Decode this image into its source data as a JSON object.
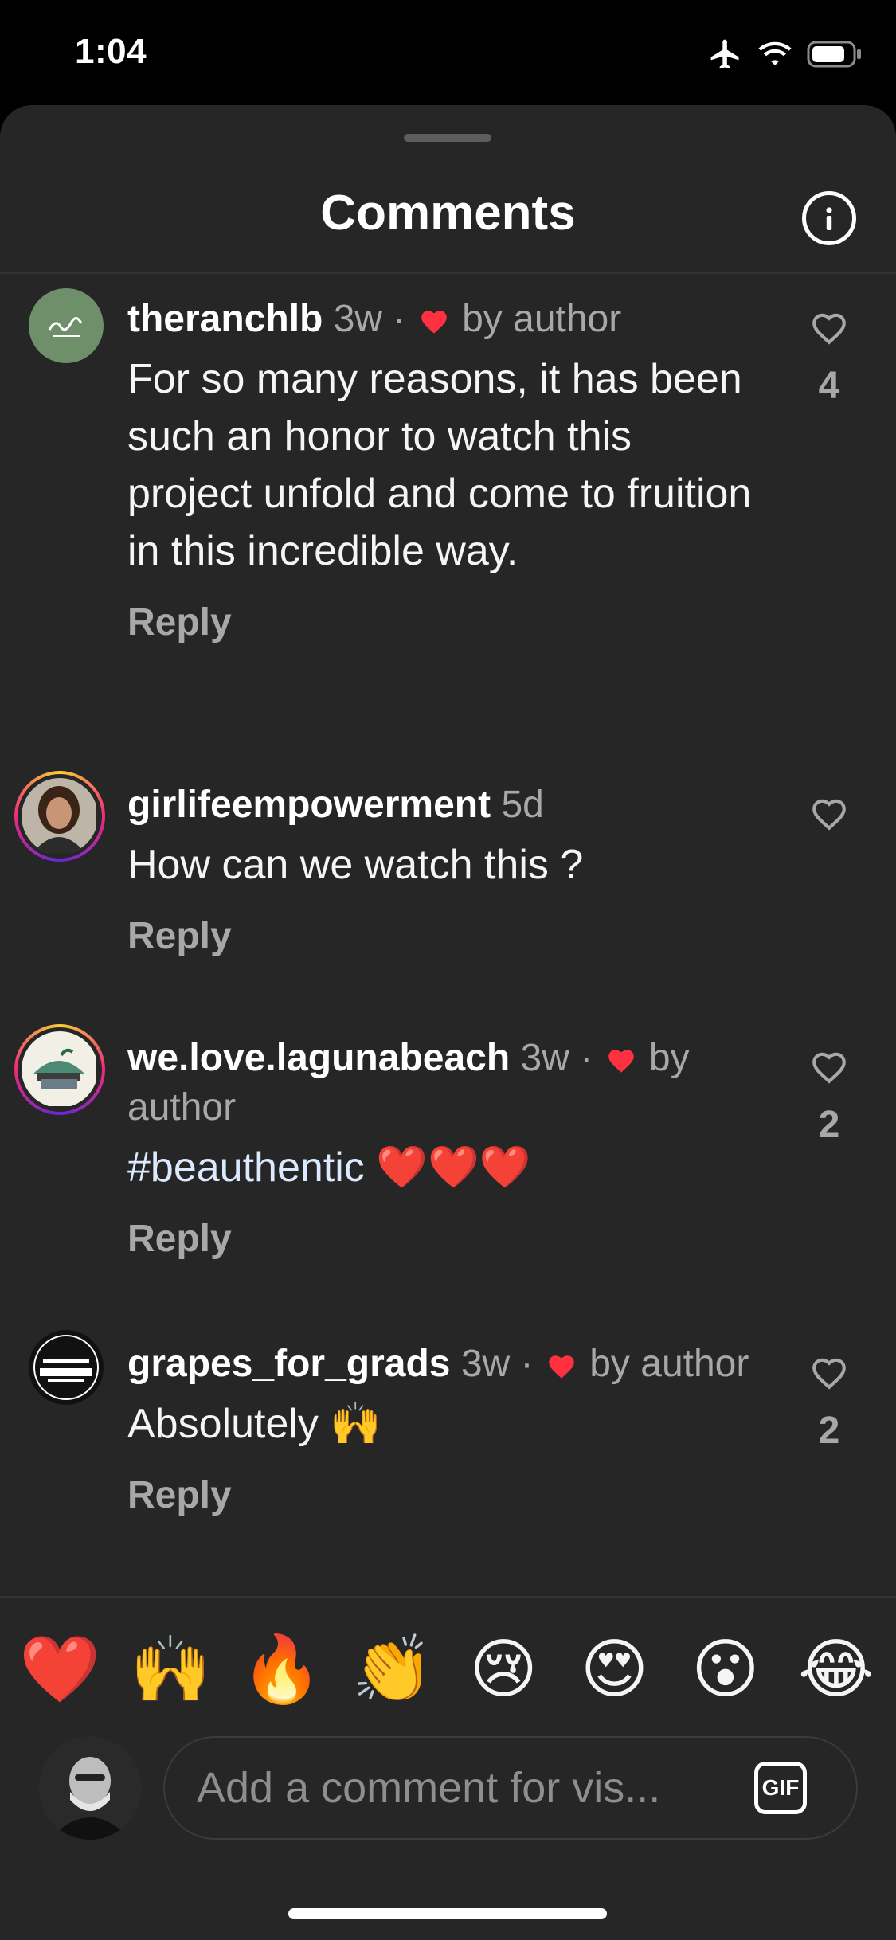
{
  "status_bar": {
    "time": "1:04"
  },
  "header": {
    "title": "Comments"
  },
  "comments": [
    {
      "username": "theranchlb",
      "time": "3w",
      "separator": "·",
      "liked_label": "by author",
      "text": "For so many reasons, it has been such an honor to watch this project unfold and come to fruition in this incredible way.",
      "reply": "Reply",
      "likes": "4"
    },
    {
      "username": "girlifeempowerment",
      "time": "5d",
      "text": "How can we watch this ?",
      "reply": "Reply"
    },
    {
      "username": "we.love.lagunabeach",
      "time": "3w",
      "separator": "·",
      "liked_label": "by author",
      "hashtag": "#beauthentic",
      "text_emoji": "❤️❤️❤️",
      "reply": "Reply",
      "likes": "2"
    },
    {
      "username": "grapes_for_grads",
      "time": "3w",
      "separator": "·",
      "liked_label": "by author",
      "text": "Absolutely 🙌",
      "reply": "Reply",
      "likes": "2"
    }
  ],
  "emoji_bar": [
    "❤️",
    "🙌",
    "🔥",
    "👏",
    "😢",
    "😍",
    "😮",
    "😂"
  ],
  "composer": {
    "placeholder": "Add a comment for vis...",
    "gif_label": "GIF"
  },
  "colors": {
    "sheet_background": "#262626",
    "author_heart": "#ff3040",
    "secondary_text": "#a8a8a8"
  }
}
